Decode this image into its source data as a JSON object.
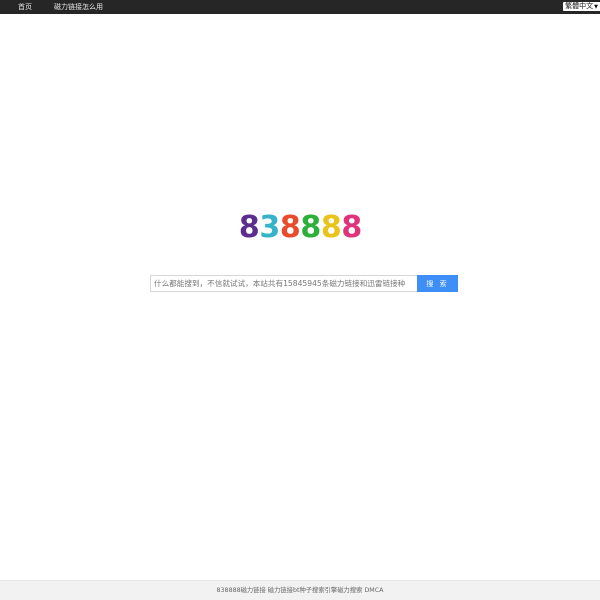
{
  "nav": {
    "home_label": "首页",
    "howto_label": "磁力链接怎么用",
    "language": {
      "selected": "繁體中文",
      "caret_icon": "triangle-down-icon"
    }
  },
  "logo": {
    "digits": [
      {
        "char": "8",
        "color": "#5b2d8e"
      },
      {
        "char": "3",
        "color": "#35b3c9"
      },
      {
        "char": "8",
        "color": "#e84c2b"
      },
      {
        "char": "8",
        "color": "#2cb03a"
      },
      {
        "char": "8",
        "color": "#e8c31a"
      },
      {
        "char": "8",
        "color": "#e0337a"
      }
    ]
  },
  "search": {
    "placeholder": "什么都能搜到，不信就试试，本站共有15845945条磁力链接和迅雷链接种",
    "button_label": "搜 索",
    "button_color": "#3e8ef7"
  },
  "footer": {
    "links": [
      "838888磁力链接",
      "磁力链接bt种子搜索引擎磁力搜索",
      "DMCA"
    ]
  }
}
